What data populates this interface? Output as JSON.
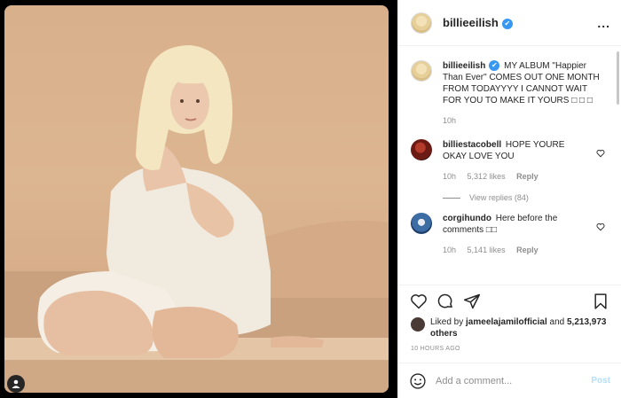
{
  "post": {
    "author": "billieeilish",
    "verified_mark": "✔",
    "more_label": "...",
    "caption": "MY ALBUM \"Happier Than Ever\" COMES OUT ONE MONTH FROM TODAYYYY I CANNOT WAIT FOR YOU TO MAKE IT YOURS □ □ □",
    "caption_age": "10h"
  },
  "comments": [
    {
      "user": "billiestacobell",
      "text": "HOPE YOURE OKAY LOVE YOU",
      "age": "10h",
      "likes": "5,312 likes",
      "reply": "Reply",
      "view_replies": "View replies (84)",
      "avatar_color": "#6b1a14"
    },
    {
      "user": "corgihundo",
      "text": "Here before the comments □□",
      "age": "10h",
      "likes": "5,141 likes",
      "reply": "Reply",
      "avatar_color": "#3c6ea5"
    }
  ],
  "likes": {
    "prefix": "Liked by",
    "user": "jameelajamilofficial",
    "and": "and",
    "count": "5,213,973 others"
  },
  "timestamp": "10 HOURS AGO",
  "add_comment": {
    "placeholder": "Add a comment...",
    "post_label": "Post"
  },
  "icons": [
    "heart-icon",
    "comment-icon",
    "share-icon",
    "bookmark-icon",
    "emoji-icon",
    "user-tag-icon",
    "more-icon",
    "verified-icon"
  ],
  "colors": {
    "verified": "#3897f0",
    "post_disabled": "#b2dffc",
    "meta_gray": "#8e8e8e"
  }
}
